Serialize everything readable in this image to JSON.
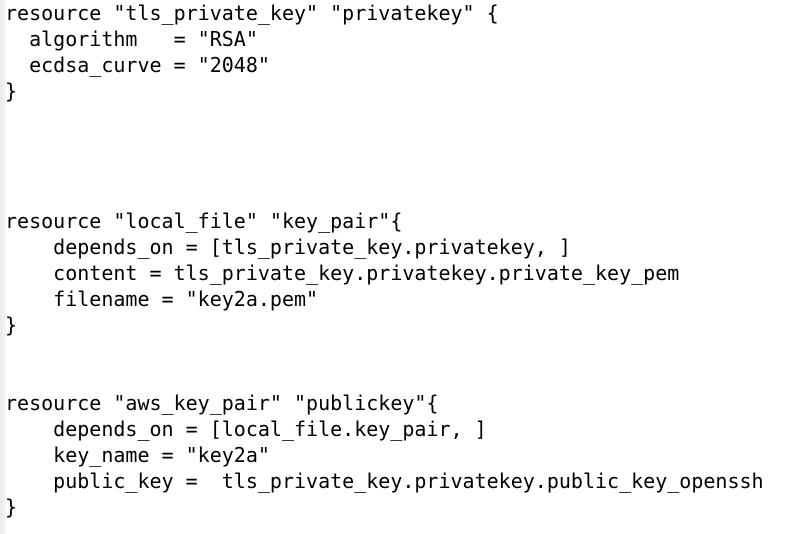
{
  "editor": {
    "lines": [
      "resource \"tls_private_key\" \"privatekey\" {",
      "  algorithm   = \"RSA\"",
      "  ecdsa_curve = \"2048\"",
      "}",
      "",
      "",
      "",
      "",
      "resource \"local_file\" \"key_pair\"{",
      "    depends_on = [tls_private_key.privatekey, ]",
      "    content = tls_private_key.privatekey.private_key_pem",
      "    filename = \"key2a.pem\"",
      "}",
      "",
      "",
      "resource \"aws_key_pair\" \"publickey\"{",
      "    depends_on = [local_file.key_pair, ]",
      "    key_name = \"key2a\"",
      "    public_key =  tls_private_key.privatekey.public_key_openssh",
      "}"
    ]
  }
}
